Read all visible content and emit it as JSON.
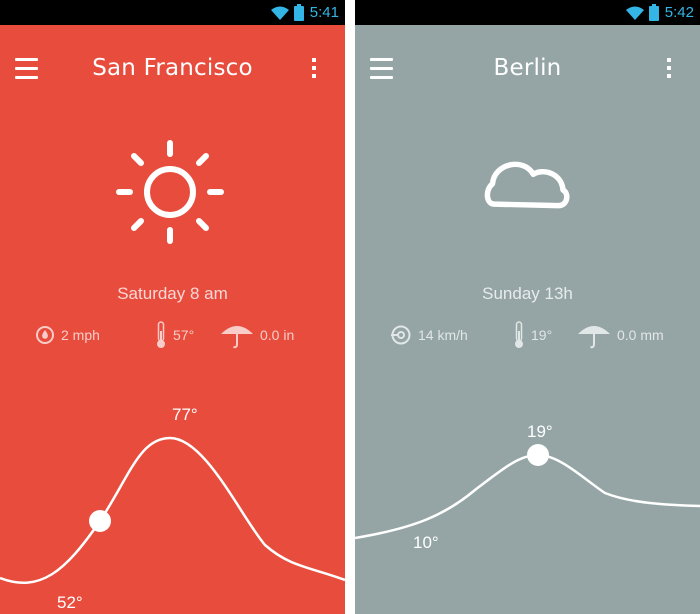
{
  "left_screen": {
    "colors": {
      "background": "#e84c3d"
    },
    "status_bar": {
      "time": "5:41"
    },
    "app_bar": {
      "city": "San Francisco"
    },
    "weather_icon": "sun-icon",
    "day_time": "Saturday 8 am",
    "details": {
      "wind": {
        "icon": "wind-drop-icon",
        "value": "2 mph"
      },
      "temperature": {
        "icon": "thermometer-icon",
        "value": "57°"
      },
      "precipitation": {
        "icon": "umbrella-icon",
        "value": "0.0 in"
      }
    },
    "temperature_curve": {
      "high_label": "77°",
      "low_label": "52°"
    }
  },
  "right_screen": {
    "colors": {
      "background": "#95a5a5"
    },
    "status_bar": {
      "time": "5:42"
    },
    "app_bar": {
      "city": "Berlin"
    },
    "weather_icon": "cloud-icon",
    "day_time": "Sunday 13h",
    "details": {
      "wind": {
        "icon": "wind-circle-icon",
        "value": "14 km/h"
      },
      "temperature": {
        "icon": "thermometer-icon",
        "value": "19°"
      },
      "precipitation": {
        "icon": "umbrella-icon",
        "value": "0.0 mm"
      }
    },
    "temperature_curve": {
      "high_label": "19°",
      "low_label": "10°"
    }
  }
}
